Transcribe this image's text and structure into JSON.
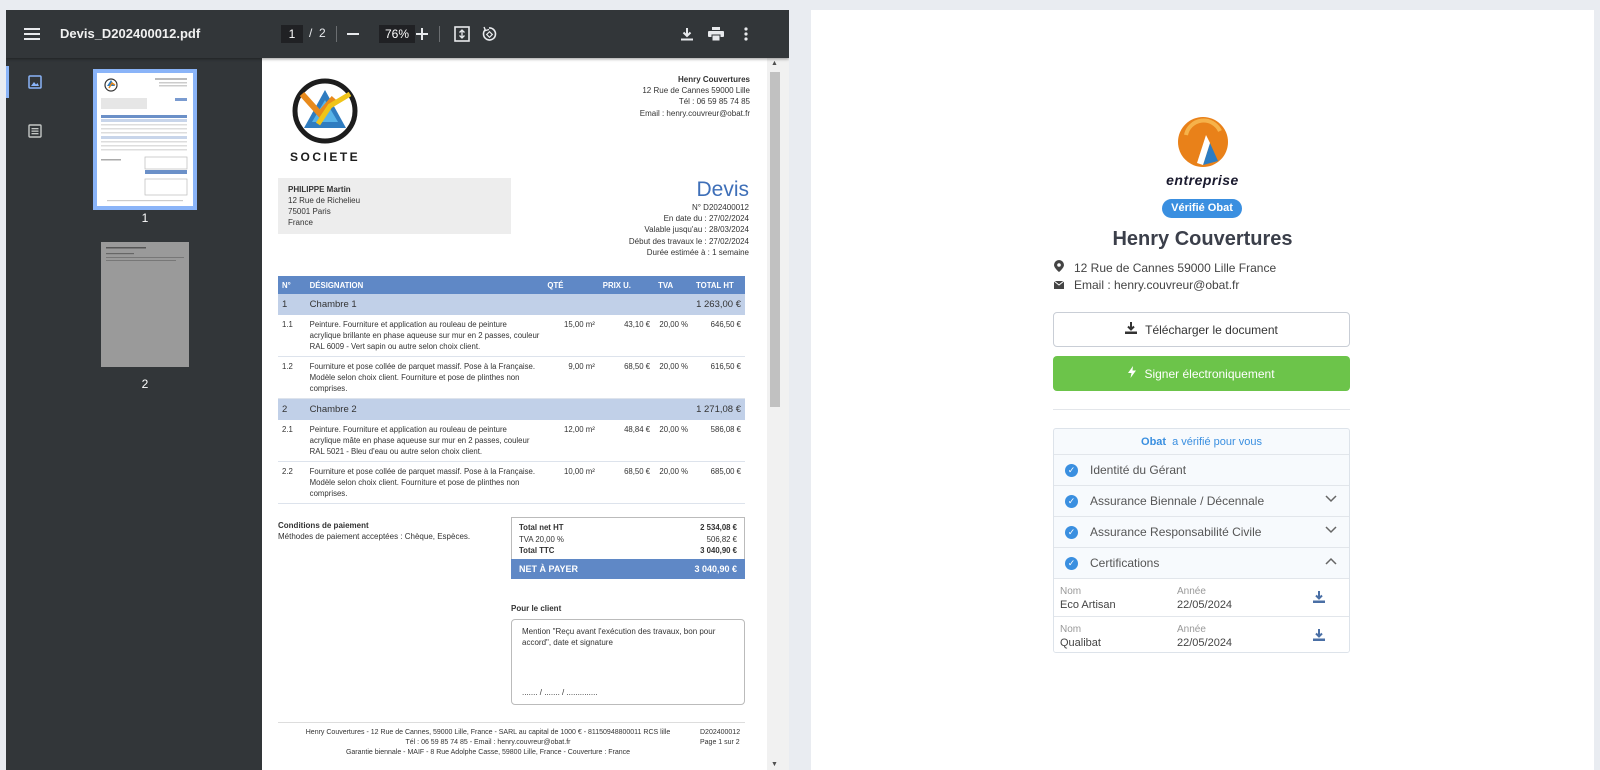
{
  "viewer": {
    "filename": "Devis_D202400012.pdf",
    "page_current": "1",
    "page_total": "2",
    "zoom": "76%",
    "thumb_labels": [
      "1",
      "2"
    ]
  },
  "pdf": {
    "logo_text": "SOCIETE",
    "company": {
      "name": "Henry Couvertures",
      "address": "12 Rue de Cannes 59000 Lille",
      "phone": "Tél : 06 59 85 74 85",
      "email": "Email : henry.couvreur@obat.fr"
    },
    "client": {
      "name": "PHILIPPE Martin",
      "street": "12 Rue de Richelieu",
      "city": "75001 Paris",
      "country": "France"
    },
    "title": "Devis",
    "meta": [
      "N° D202400012",
      "En date du : 27/02/2024",
      "Valable jusqu'au : 28/03/2024",
      "Début des travaux le : 27/02/2024",
      "Durée estimée à : 1 semaine"
    ],
    "headers": [
      "N°",
      "DÉSIGNATION",
      "QTÉ",
      "PRIX U.",
      "TVA",
      "TOTAL HT"
    ],
    "sections": [
      {
        "num": "1",
        "name": "Chambre 1",
        "total": "1 263,00 €",
        "lines": [
          {
            "num": "1.1",
            "designation": "Peinture. Fourniture et application au rouleau de peinture acrylique brillante en phase aqueuse sur mur en 2 passes, couleur RAL 6009 - Vert sapin ou autre selon choix client.",
            "qty": "15,00 m²",
            "pu": "43,10 €",
            "tva": "20,00 %",
            "total": "646,50 €"
          },
          {
            "num": "1.2",
            "designation": "Fourniture et pose collée de parquet massif. Pose à la Française. Modèle selon choix client. Fourniture et pose de plinthes non comprises.",
            "qty": "9,00 m²",
            "pu": "68,50 €",
            "tva": "20,00 %",
            "total": "616,50 €"
          }
        ]
      },
      {
        "num": "2",
        "name": "Chambre 2",
        "total": "1 271,08 €",
        "lines": [
          {
            "num": "2.1",
            "designation": "Peinture. Fourniture et application au rouleau de peinture acrylique mâte en phase aqueuse sur mur en 2 passes, couleur RAL 5021 - Bleu d'eau ou autre selon choix client.",
            "qty": "12,00 m²",
            "pu": "48,84 €",
            "tva": "20,00 %",
            "total": "586,08 €"
          },
          {
            "num": "2.2",
            "designation": "Fourniture et pose collée de parquet massif. Pose à la Française. Modèle selon choix client. Fourniture et pose de plinthes non comprises.",
            "qty": "10,00 m²",
            "pu": "68,50 €",
            "tva": "20,00 %",
            "total": "685,00 €"
          }
        ]
      }
    ],
    "conditions_title": "Conditions de paiement",
    "conditions_text": "Méthodes de paiement acceptées : Chèque, Espèces.",
    "totals": {
      "net_ht_label": "Total net HT",
      "net_ht": "2 534,08 €",
      "tva_label": "TVA 20,00 %",
      "tva": "506,82 €",
      "ttc_label": "Total TTC",
      "ttc": "3 040,90 €",
      "pay_label": "NET À PAYER",
      "pay": "3 040,90 €"
    },
    "client_title": "Pour le client",
    "mention": "Mention \"Reçu avant l'exécution des travaux, bon pour accord\", date et signature",
    "mention_dots": "....... / ....... / ..............",
    "footer": {
      "line1": "Henry Couvertures - 12 Rue de Cannes, 59000 Lille, France - SARL au capital de 1000 € - 81150948800011 RCS lille",
      "line2": "Tél : 06 59 85 74 85 - Email : henry.couvreur@obat.fr",
      "line3": "Garantie biennale - MAIF - 8 Rue Adolphe Casse, 59800 Lille, France - Couverture : France",
      "ref": "D202400012",
      "page": "Page 1 sur 2"
    }
  },
  "card": {
    "logo_text": "entreprise",
    "verified_badge": "Vérifié  Obat",
    "company_name": "Henry Couvertures",
    "address": "12 Rue de Cannes 59000 Lille France",
    "email": "Email : henry.couvreur@obat.fr",
    "download_button": "Télécharger le document",
    "sign_button": "Signer électroniquement",
    "verified_header_brand": "Obat",
    "verified_header_text": "a vérifié pour vous",
    "checks": [
      {
        "label": "Identité du Gérant",
        "chevron": ""
      },
      {
        "label": "Assurance Biennale / Décennale",
        "chevron": "down"
      },
      {
        "label": "Assurance Responsabilité Civile",
        "chevron": "down"
      },
      {
        "label": "Certifications",
        "chevron": "up"
      }
    ],
    "cert_name_label": "Nom",
    "cert_year_label": "Année",
    "certifications": [
      {
        "name": "Eco Artisan",
        "year": "22/05/2024"
      },
      {
        "name": "Qualibat",
        "year": "22/05/2024"
      }
    ],
    "colors": {
      "accent": "#3a8fe0",
      "sign": "#6cc44a",
      "table_header": "#5f88c6",
      "section_row": "#c1d0e8"
    }
  }
}
